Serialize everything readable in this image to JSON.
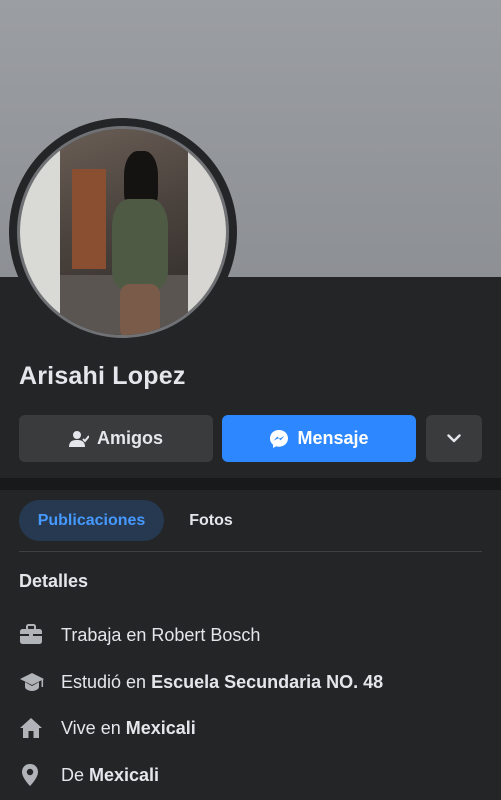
{
  "profile": {
    "name": "Arisahi Lopez"
  },
  "actions": {
    "friends_label": "Amigos",
    "message_label": "Mensaje",
    "more_icon": "chevron-down-icon"
  },
  "tabs": [
    {
      "label": "Publicaciones",
      "active": true
    },
    {
      "label": "Fotos",
      "active": false
    }
  ],
  "details": {
    "title": "Detalles",
    "items": [
      {
        "icon": "briefcase-icon",
        "prefix": "Trabaja en Robert Bosch",
        "value": ""
      },
      {
        "icon": "graduation-cap-icon",
        "prefix": "Estudió en ",
        "value": "Escuela Secundaria NO. 48"
      },
      {
        "icon": "home-icon",
        "prefix": "Vive en ",
        "value": "Mexicali"
      },
      {
        "icon": "location-pin-icon",
        "prefix": "De ",
        "value": "Mexicali"
      }
    ]
  },
  "colors": {
    "background": "#242526",
    "accent": "#2d88ff",
    "tab_active_bg": "#263951",
    "tab_active_text": "#4599ff"
  }
}
